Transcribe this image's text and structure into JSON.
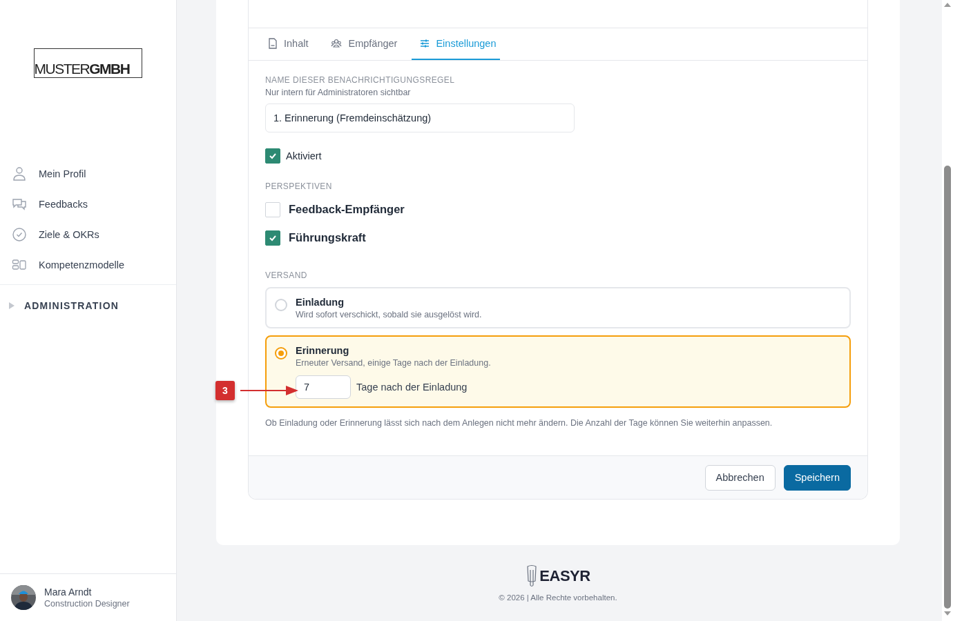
{
  "sidebar": {
    "logo": "MUSTER**GMBH**",
    "items": [
      {
        "label": "Mein Profil"
      },
      {
        "label": "Feedbacks"
      },
      {
        "label": "Ziele & OKRs"
      },
      {
        "label": "Kompetenzmodelle"
      }
    ],
    "section": {
      "label": "ADMINISTRATION",
      "expanded": false
    },
    "user": {
      "name": "Mara Arndt",
      "role": "Construction Designer"
    }
  },
  "tabs": [
    {
      "label": "Inhalt",
      "selected": false
    },
    {
      "label": "Empfänger",
      "selected": false
    },
    {
      "label": "Einstellungen",
      "selected": true
    }
  ],
  "form": {
    "name_field": {
      "label": "NAME DIESER BENACHRICHTIGUNGSREGEL",
      "hint": "Nur intern für Administratoren sichtbar",
      "value": "1. Erinnerung (Fremdeinschätzung)"
    },
    "activated": {
      "label": "Aktiviert",
      "checked": true
    },
    "perspectives": {
      "label": "PERSPEKTIVEN",
      "options": [
        {
          "label": "Feedback-Empfänger",
          "checked": false
        },
        {
          "label": "Führungskraft",
          "checked": true
        }
      ]
    },
    "delivery": {
      "label": "VERSAND",
      "options": [
        {
          "title": "Einladung",
          "description": "Wird sofort verschickt, sobald sie ausgelöst wird.",
          "selected": false
        },
        {
          "title": "Erinnerung",
          "description": "Erneuter Versand, einige Tage nach der Einladung.",
          "selected": true,
          "days": {
            "value": "7",
            "suffix": "Tage nach der Einladung"
          }
        }
      ],
      "note": "Ob Einladung oder Erinnerung lässt sich nach dem Anlegen nicht mehr ändern. Die Anzahl der Tage können Sie weiterhin anpassen."
    }
  },
  "buttons": [
    {
      "label": "Abbrechen",
      "kind": "secondary"
    },
    {
      "label": "Speichern",
      "kind": "primary"
    }
  ],
  "annotation": {
    "label": "3"
  },
  "page_footer": {
    "brand": "EASYR",
    "copyright": "© 2026 | Alle Rechte vorbehalten."
  }
}
